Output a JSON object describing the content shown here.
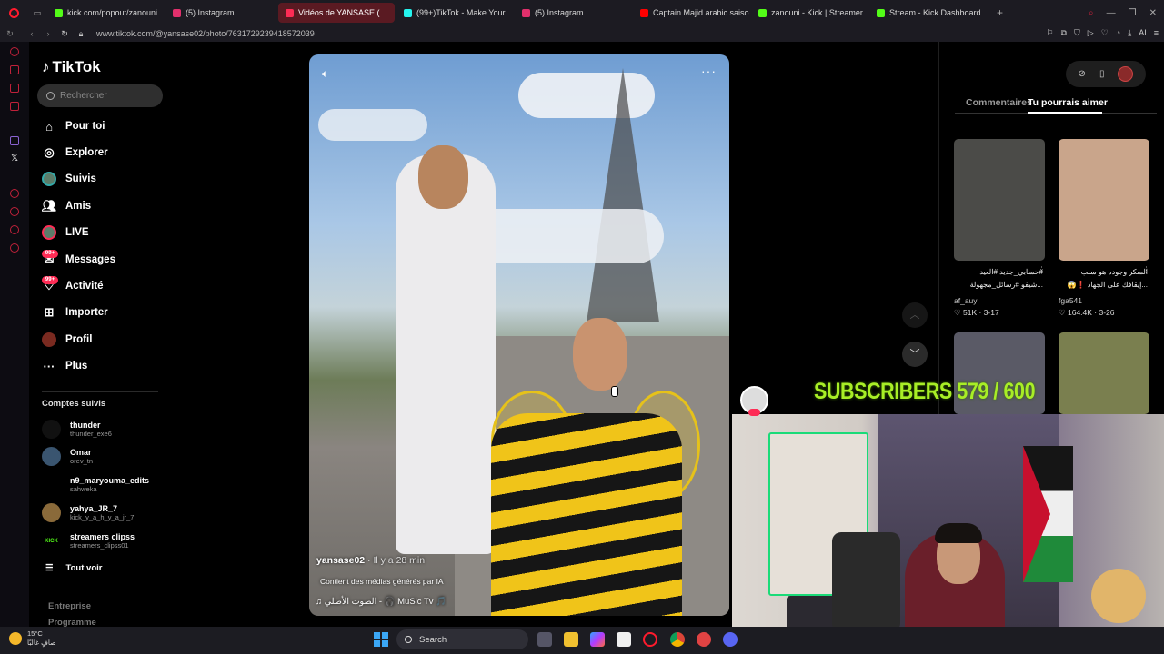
{
  "browser": {
    "tabs": [
      {
        "label": "kick.com/popout/zanouni",
        "color": "#53fc18",
        "active": false
      },
      {
        "label": "(5) Instagram",
        "color": "#e1306c",
        "active": false
      },
      {
        "label": "Vidéos de YANSASE (",
        "color": "#fe2c55",
        "active": true
      },
      {
        "label": "(99+)TikTok - Make Your",
        "color": "#25f4ee",
        "active": false
      },
      {
        "label": "(5) Instagram",
        "color": "#e1306c",
        "active": false
      },
      {
        "label": "Captain Majid arabic saiso",
        "color": "#ff0000",
        "active": false
      },
      {
        "label": "zanouni - Kick | Streamer",
        "color": "#53fc18",
        "active": false
      },
      {
        "label": "Stream - Kick Dashboard",
        "color": "#53fc18",
        "active": false
      }
    ],
    "new_tab": "+",
    "url": "www.tiktok.com/@yansase02/photo/7631729239418572039",
    "ai_label": "AI"
  },
  "tiktok": {
    "logo": "TikTok",
    "search_placeholder": "Rechercher",
    "nav": [
      {
        "label": "Pour toi",
        "icon": "home-icon"
      },
      {
        "label": "Explorer",
        "icon": "compass-icon"
      },
      {
        "label": "Suivis",
        "icon": "following-avatar-icon"
      },
      {
        "label": "Amis",
        "icon": "friends-icon"
      },
      {
        "label": "LIVE",
        "icon": "live-icon"
      },
      {
        "label": "Messages",
        "icon": "messages-icon",
        "badge": "99+"
      },
      {
        "label": "Activité",
        "icon": "activity-icon",
        "badge": "99+"
      },
      {
        "label": "Importer",
        "icon": "upload-icon"
      },
      {
        "label": "Profil",
        "icon": "profile-icon"
      },
      {
        "label": "Plus",
        "icon": "more-icon"
      }
    ],
    "followed_heading": "Comptes suivis",
    "followed": [
      {
        "name": "thunder",
        "user": "thunder_exe6"
      },
      {
        "name": "Omar",
        "user": "orev_tn"
      },
      {
        "name": "n9_maryouma_edits",
        "user": "sahweka"
      },
      {
        "name": "yahya_JR_7",
        "user": "kick_y_a_h_y_a_jr_7"
      },
      {
        "name": "streamers clipss",
        "user": "streamers_clipss01",
        "avatar_text": "KICK"
      }
    ],
    "see_all": "Tout voir",
    "footer": [
      "Entreprise",
      "Programme"
    ]
  },
  "video": {
    "author": "yansase02",
    "ago": " · Il y a 28 min",
    "ai_notice": "Contient des médias générés par IA",
    "music": "♫  الصوت الأصلي - 🎧 MuSic Tv 🎵"
  },
  "panel": {
    "tab_comments": "Commentaires",
    "tab_like": "Tu pourrais aimer",
    "items": [
      {
        "caption": "#حسابي_جديد #العيد\n...شيفو #رسائل_مجهولة",
        "user": "af_auy",
        "likes": "51K",
        "date": "3-17",
        "bg": "#4b4b48"
      },
      {
        "caption": "السكر وجوده هو سبب\n...إيقافك على الجهاد ❗😱",
        "user": "fga541",
        "likes": "164.4K",
        "date": "3-26",
        "bg": "#c9a58b"
      },
      {
        "bg": "#5a5a66"
      },
      {
        "bg": "#7a7f4f"
      }
    ]
  },
  "stream": {
    "subscribers_text": "SUBSCRIBERS 579 / 600"
  },
  "taskbar": {
    "temp": "15°C",
    "weather": "صافٍ غالبًا",
    "search": "Search"
  }
}
